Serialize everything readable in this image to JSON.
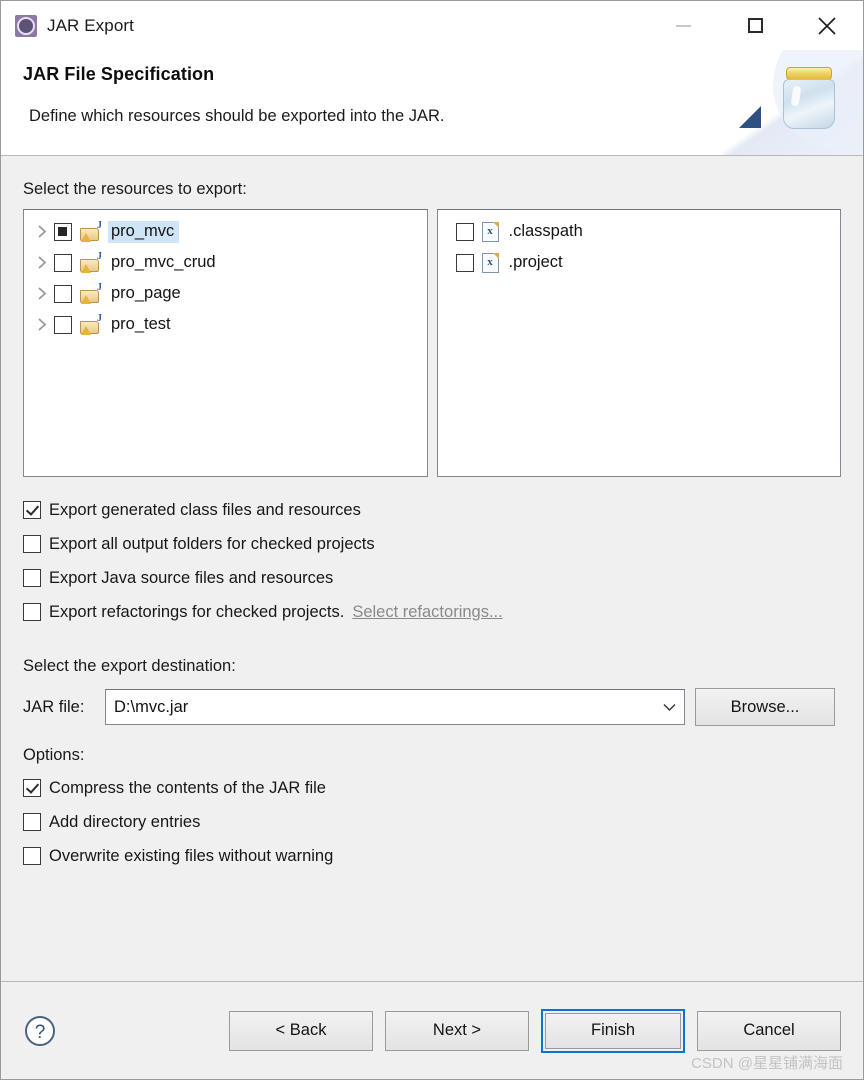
{
  "window": {
    "title": "JAR Export",
    "icon": "jar-export-gear-icon",
    "controls": {
      "minimize": "minimize-icon",
      "maximize": "maximize-icon",
      "close": "close-icon"
    }
  },
  "header": {
    "title": "JAR File Specification",
    "description": "Define which resources should be exported into the JAR.",
    "art_icon": "jar-with-export-arrow-icon"
  },
  "resources": {
    "label": "Select the resources to export:",
    "tree": [
      {
        "label": "pro_mvc",
        "checkbox": "partial",
        "expandable": true,
        "selected": true,
        "icon": "java-project-warning-icon"
      },
      {
        "label": "pro_mvc_crud",
        "checkbox": "unchecked",
        "expandable": true,
        "selected": false,
        "icon": "java-project-warning-icon"
      },
      {
        "label": "pro_page",
        "checkbox": "unchecked",
        "expandable": true,
        "selected": false,
        "icon": "java-project-warning-icon"
      },
      {
        "label": "pro_test",
        "checkbox": "unchecked",
        "expandable": true,
        "selected": false,
        "icon": "java-project-warning-icon"
      }
    ],
    "files": [
      {
        "label": ".classpath",
        "checkbox": "unchecked",
        "icon": "xml-file-icon"
      },
      {
        "label": ".project",
        "checkbox": "unchecked",
        "icon": "xml-file-icon"
      }
    ]
  },
  "export_options": [
    {
      "label": "Export generated class files and resources",
      "checked": true
    },
    {
      "label": "Export all output folders for checked projects",
      "checked": false
    },
    {
      "label": "Export Java source files and resources",
      "checked": false
    },
    {
      "label": "Export refactorings for checked projects.",
      "checked": false,
      "link": "Select refactorings...",
      "link_enabled": false
    }
  ],
  "destination": {
    "label": "Select the export destination:",
    "file_label": "JAR file:",
    "file_value": "D:\\mvc.jar",
    "browse_label": "Browse..."
  },
  "options": {
    "title": "Options:",
    "items": [
      {
        "label": "Compress the contents of the JAR file",
        "checked": true
      },
      {
        "label": "Add directory entries",
        "checked": false
      },
      {
        "label": "Overwrite existing files without warning",
        "checked": false
      }
    ]
  },
  "footer": {
    "help_icon": "help-question-icon",
    "back_label": "< Back",
    "next_label": "Next >",
    "finish_label": "Finish",
    "cancel_label": "Cancel",
    "watermark": "CSDN @星星铺满海面"
  },
  "colors": {
    "accent": "#0a74d6",
    "selection": "#cfe5f7",
    "dialog_bg": "#f0f0f0"
  }
}
